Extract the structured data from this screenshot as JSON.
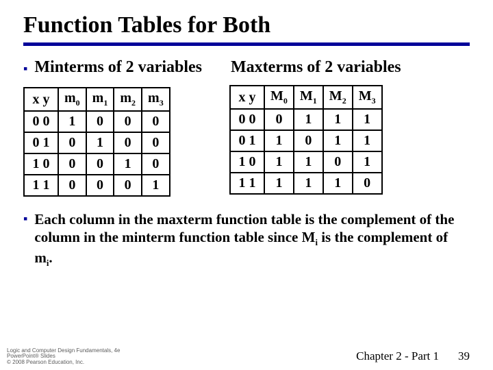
{
  "title": "Function Tables for Both",
  "left": {
    "heading": "Minterms of 2 variables",
    "xyheader": "x y",
    "cols": [
      "m0",
      "m1",
      "m2",
      "m3"
    ],
    "rows": [
      {
        "xy": "0 0",
        "v": [
          "1",
          "0",
          "0",
          "0"
        ]
      },
      {
        "xy": "0 1",
        "v": [
          "0",
          "1",
          "0",
          "0"
        ]
      },
      {
        "xy": "1 0",
        "v": [
          "0",
          "0",
          "1",
          "0"
        ]
      },
      {
        "xy": "1 1",
        "v": [
          "0",
          "0",
          "0",
          "1"
        ]
      }
    ]
  },
  "right": {
    "heading": "Maxterms of 2 variables",
    "xyheader": "x y",
    "cols": [
      "M0",
      "M1",
      "M2",
      "M3"
    ],
    "rows": [
      {
        "xy": "0 0",
        "v": [
          "0",
          "1",
          "1",
          "1"
        ]
      },
      {
        "xy": "0 1",
        "v": [
          "1",
          "0",
          "1",
          "1"
        ]
      },
      {
        "xy": "1 0",
        "v": [
          "1",
          "1",
          "0",
          "1"
        ]
      },
      {
        "xy": "1 1",
        "v": [
          "1",
          "1",
          "1",
          "0"
        ]
      }
    ]
  },
  "note_prefix": "Each column in the maxterm function table is the complement of the column in the minterm function table since M",
  "note_mid": " is the complement of m",
  "note_end": ".",
  "sub_i": "i",
  "footer": {
    "l1": "Logic and Computer Design Fundamentals, 4e",
    "l2": "PowerPoint® Slides",
    "l3": "© 2008 Pearson Education, Inc.",
    "chapter": "Chapter 2 - Part 1",
    "page": "39"
  },
  "chart_data": [
    {
      "type": "table",
      "title": "Minterms of 2 variables",
      "columns": [
        "x y",
        "m0",
        "m1",
        "m2",
        "m3"
      ],
      "rows": [
        [
          "0 0",
          1,
          0,
          0,
          0
        ],
        [
          "0 1",
          0,
          1,
          0,
          0
        ],
        [
          "1 0",
          0,
          0,
          1,
          0
        ],
        [
          "1 1",
          0,
          0,
          0,
          1
        ]
      ]
    },
    {
      "type": "table",
      "title": "Maxterms of 2 variables",
      "columns": [
        "x y",
        "M0",
        "M1",
        "M2",
        "M3"
      ],
      "rows": [
        [
          "0 0",
          0,
          1,
          1,
          1
        ],
        [
          "0 1",
          1,
          0,
          1,
          1
        ],
        [
          "1 0",
          1,
          1,
          0,
          1
        ],
        [
          "1 1",
          1,
          1,
          1,
          0
        ]
      ]
    }
  ]
}
